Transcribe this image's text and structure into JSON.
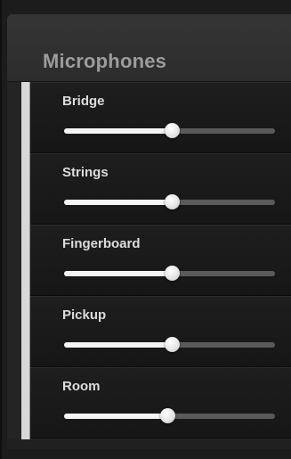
{
  "panel": {
    "title": "Microphones"
  },
  "microphones": [
    {
      "label": "Bridge",
      "level": 0.51
    },
    {
      "label": "Strings",
      "level": 0.51
    },
    {
      "label": "Fingerboard",
      "level": 0.51
    },
    {
      "label": "Pickup",
      "level": 0.51
    },
    {
      "label": "Room",
      "level": 0.49
    }
  ]
}
